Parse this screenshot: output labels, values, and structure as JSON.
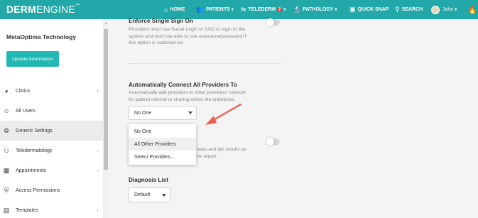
{
  "header": {
    "logo_bold": "DERM",
    "logo_light": "ENGINE",
    "logo_tm": "™",
    "nav": [
      {
        "label": "HOME",
        "icon": "home-icon",
        "glyph": "⌂",
        "caret": ""
      },
      {
        "label": "PATIENTS",
        "icon": "patients-icon",
        "glyph": "👥",
        "caret": "▾"
      },
      {
        "label": "TELEDERM",
        "icon": "telederm-icon",
        "glyph": "⇋",
        "caret": "▾",
        "badge": "7"
      },
      {
        "label": "PATHOLOGY",
        "icon": "microscope-icon",
        "glyph": "🔬",
        "caret": "▾"
      },
      {
        "label": "QUICK SNAP",
        "icon": "camera-icon",
        "glyph": "▣",
        "caret": ""
      },
      {
        "label": "SEARCH",
        "icon": "search-icon",
        "glyph": "⚲",
        "caret": ""
      }
    ],
    "user": {
      "name": "John",
      "caret": "▾"
    },
    "notification_glyph": "🔥",
    "accent": "#22a8a8"
  },
  "sidebar": {
    "org_name": "MetaOptima Technology",
    "update_button": "Update Information",
    "items": [
      {
        "label": "Clinics",
        "icon": "clinics-pie-icon",
        "glyph": "◕",
        "chevron": "‹"
      },
      {
        "label": "All Users",
        "icon": "users-icon",
        "glyph": "☺",
        "chevron": ""
      },
      {
        "label": "Generic Settings",
        "icon": "gear-icon",
        "glyph": "⚙",
        "chevron": "",
        "active": true
      },
      {
        "label": "Teledermatology",
        "icon": "telederm-user-icon",
        "glyph": "⚇",
        "chevron": "‹"
      },
      {
        "label": "Appointments",
        "icon": "calendar-icon",
        "glyph": "▦",
        "chevron": "‹"
      },
      {
        "label": "Access Permissions",
        "icon": "permissions-icon",
        "glyph": "⛨",
        "chevron": ""
      },
      {
        "label": "Templates",
        "icon": "templates-icon",
        "glyph": "▤",
        "chevron": "‹"
      }
    ],
    "scroll_up": "▲"
  },
  "main": {
    "sso": {
      "title": "Enforce Single Sign On",
      "desc_lines": [
        "Providers must use Social Login or SSO to login to the",
        "system and won't be able to use username/password if",
        "this option is switched on."
      ],
      "enabled": false
    },
    "connect": {
      "title": "Automatically Connect All Providers To",
      "desc_lines": [
        "Automatically add providers to other providers' network",
        "for patient referral or sharing within the enterprise."
      ],
      "selected": "No One",
      "options": [
        "No One",
        "All Other Providers",
        "Select Providers..."
      ],
      "highlighted_option": "All Other Providers"
    },
    "hidden_section": {
      "desc_fragments": [
        "ases and lab results as",
        "he report."
      ],
      "enabled": false
    },
    "diagnosis": {
      "title": "Diagnosis List",
      "selected": "Default"
    },
    "annotation_arrow_color": "#e8604f"
  }
}
